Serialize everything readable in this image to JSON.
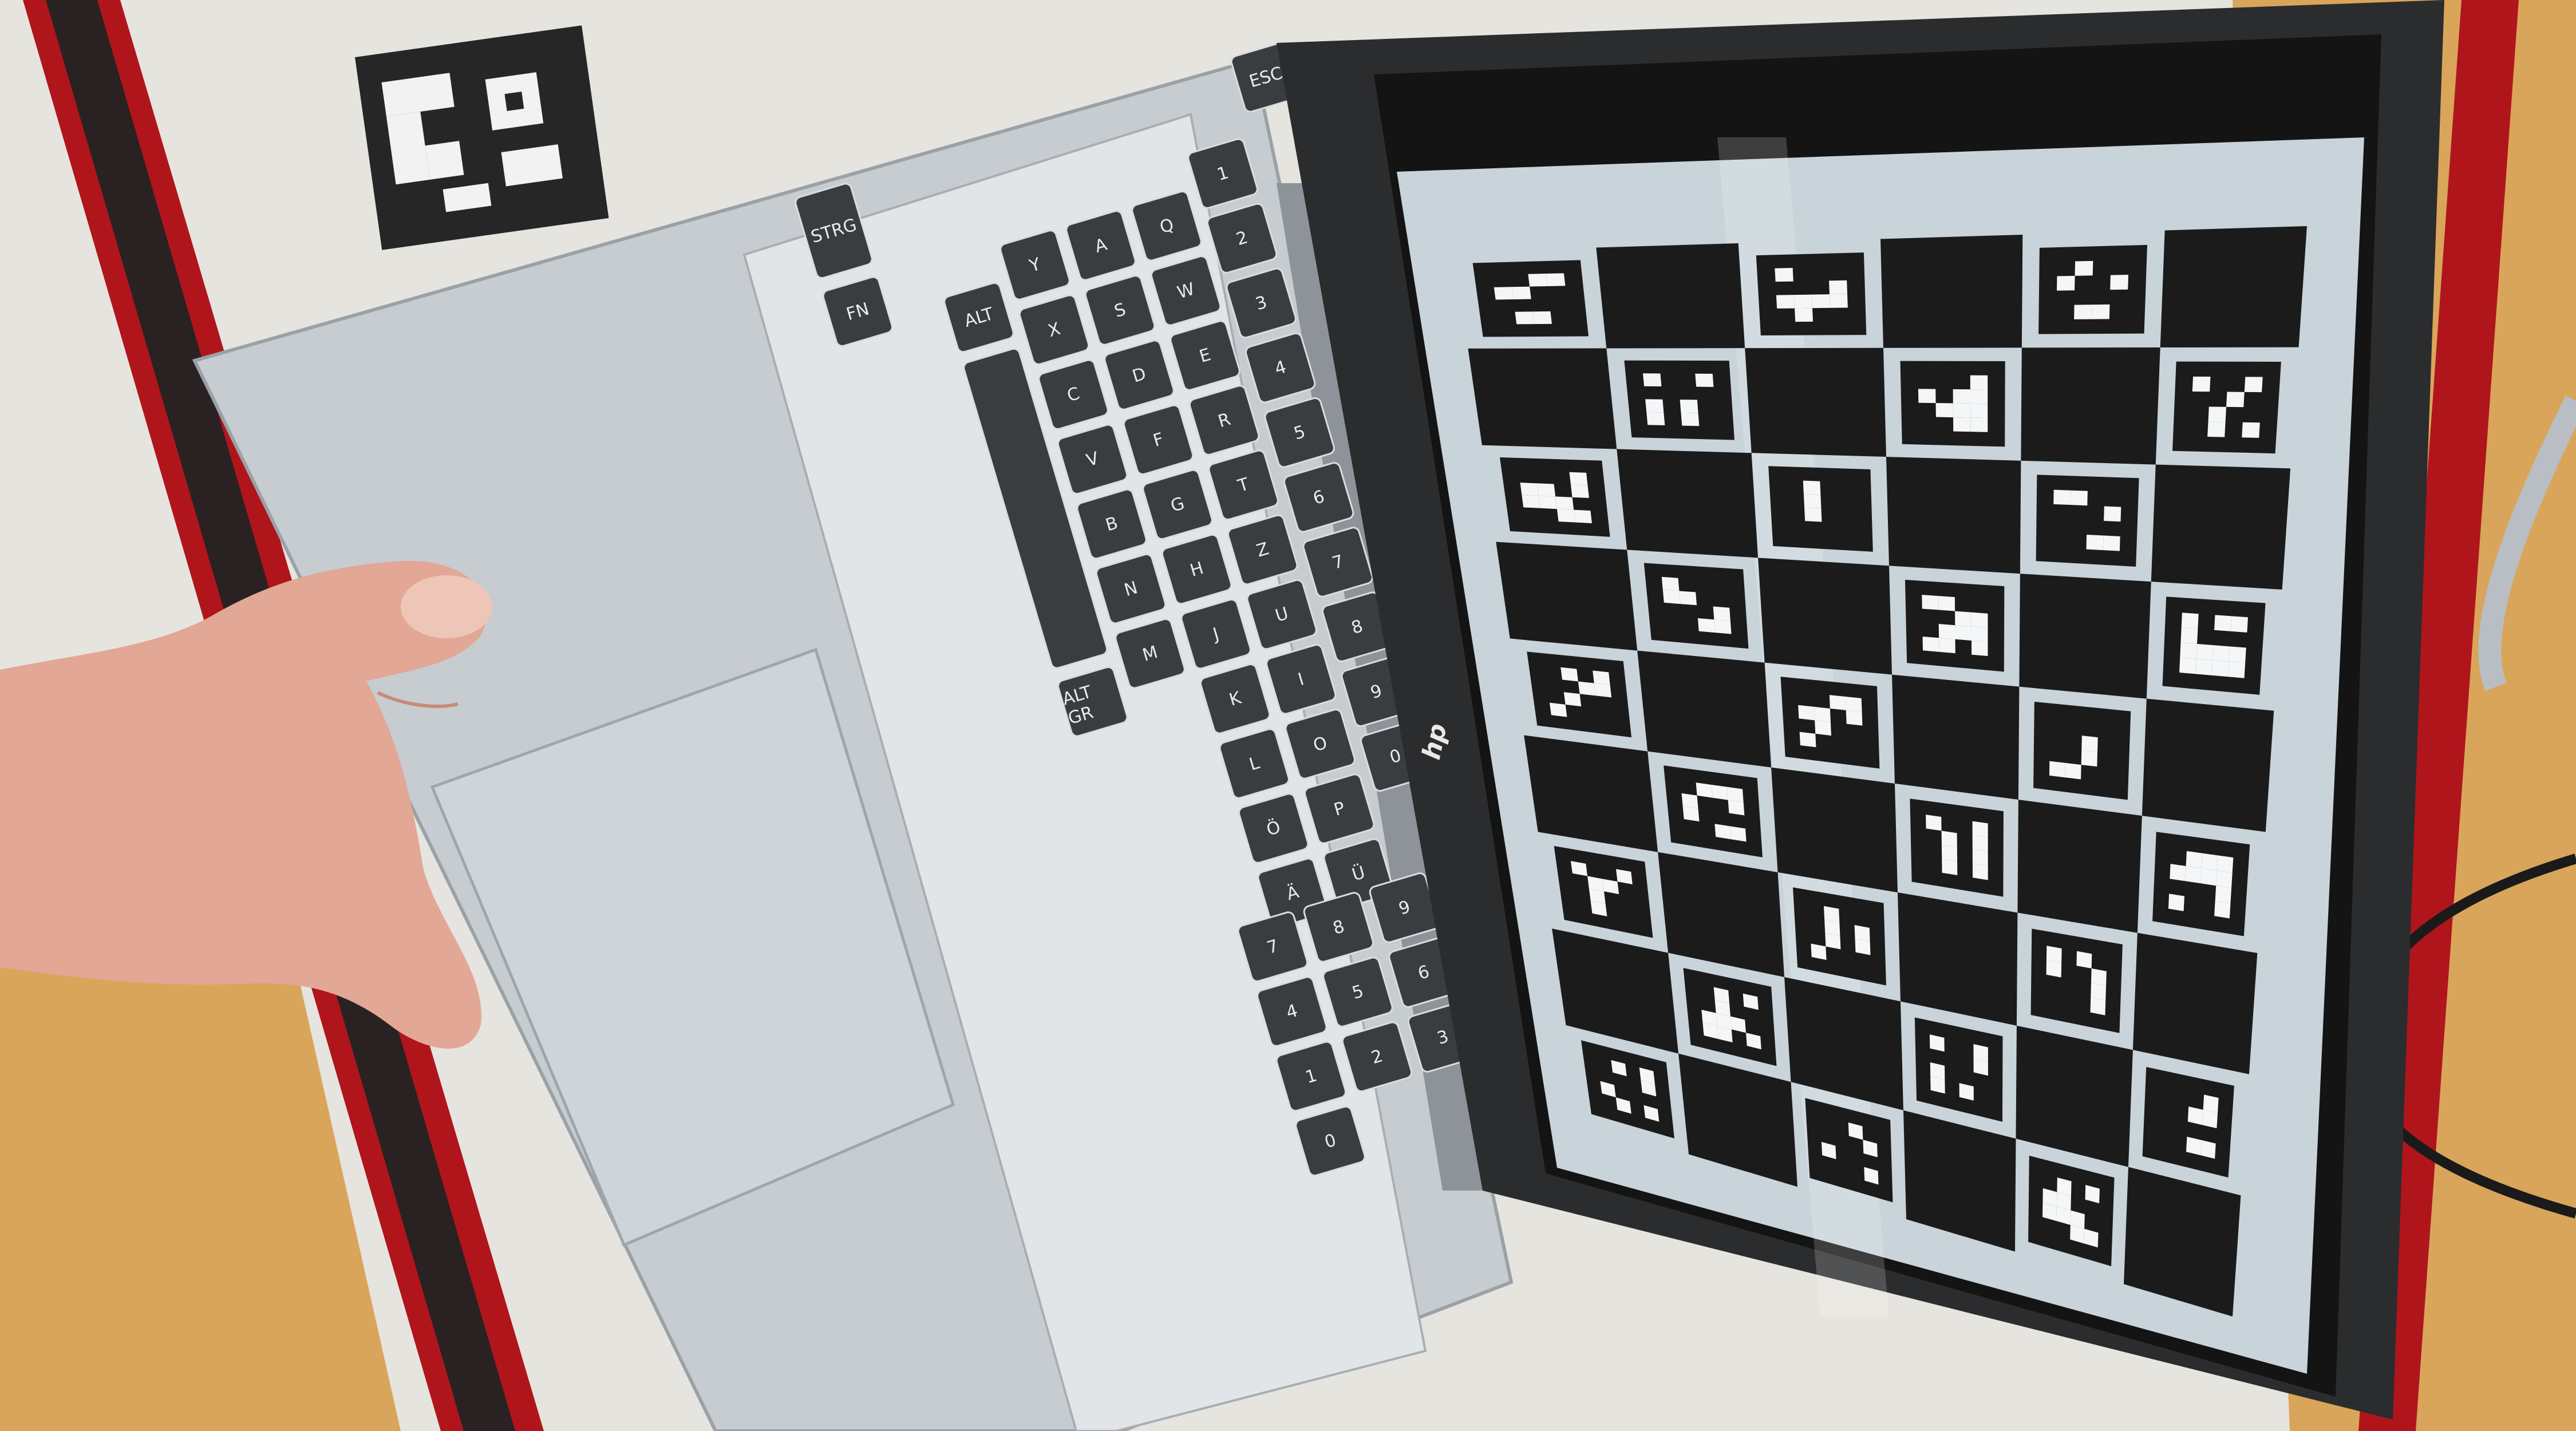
{
  "laptop": {
    "brand_logo": "hp",
    "modifier_keys": [
      "ESC",
      "STRG",
      "FN",
      "ALT",
      "ALT GR"
    ],
    "letter_keys": [
      [
        "Q",
        "W",
        "E",
        "R",
        "T",
        "Z",
        "U",
        "I",
        "O",
        "P",
        "Ü"
      ],
      [
        "A",
        "S",
        "D",
        "F",
        "G",
        "H",
        "J",
        "K",
        "L",
        "Ö",
        "Ä"
      ],
      [
        "Y",
        "X",
        "C",
        "V",
        "B",
        "N",
        "M"
      ]
    ],
    "number_keys": [
      "1",
      "2",
      "3",
      "4",
      "5",
      "6",
      "7",
      "8",
      "9",
      "0"
    ],
    "numpad_keys": [
      "7",
      "8",
      "9",
      "4",
      "5",
      "6",
      "1",
      "2",
      "3",
      "0"
    ]
  },
  "screen": {
    "pattern": "ChArUco calibration board",
    "rows": 9,
    "cols": 6
  },
  "colors": {
    "screen_light": "#c9d3da",
    "board_dark": "#1b1b1b",
    "laptop_body": "#c7ccd0",
    "desk": "#d9a55a",
    "frame_red": "#c3141b"
  }
}
